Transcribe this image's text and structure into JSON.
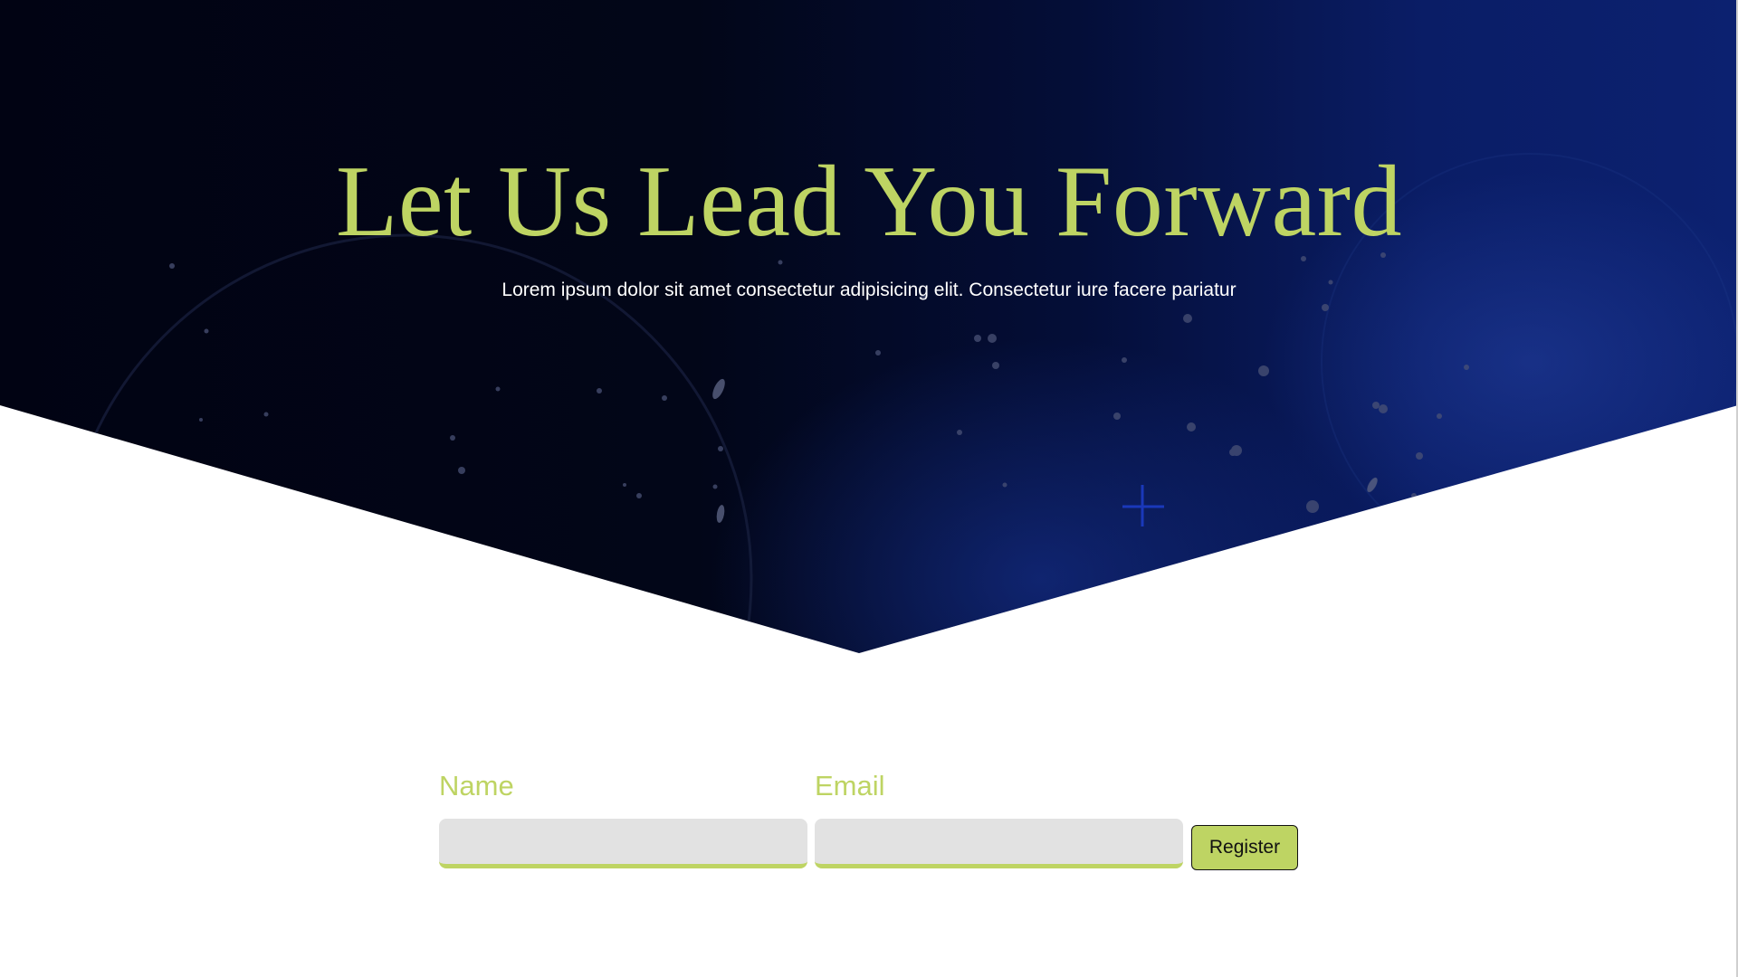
{
  "hero": {
    "title": "Let Us Lead You Forward",
    "subtitle": "Lorem ipsum dolor sit amet consectetur adipisicing elit. Consectetur iure facere pariatur"
  },
  "form": {
    "name_label": "Name",
    "name_value": "",
    "email_label": "Email",
    "email_value": "",
    "register_label": "Register"
  },
  "colors": {
    "accent": "#bed463",
    "hero_dark": "#010313",
    "hero_blue": "#0c2170",
    "input_bg": "#e2e2e2",
    "white": "#ffffff"
  },
  "icons": {
    "hero_cross": "plus-icon"
  }
}
